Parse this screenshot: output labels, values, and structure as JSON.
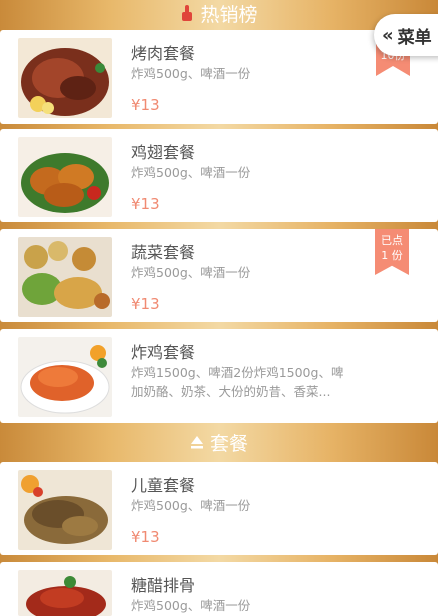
{
  "sections": {
    "hot": {
      "title": "热销榜",
      "icon": "thumb-up-icon"
    },
    "combo": {
      "title": "套餐",
      "icon": "eject-icon"
    }
  },
  "menu_tab": {
    "label": "菜单",
    "icon": "double-chevron-left-icon"
  },
  "items": [
    {
      "name": "烤肉套餐",
      "desc": "炸鸡500g、啤酒一份",
      "price": "¥13",
      "badge": "10份"
    },
    {
      "name": "鸡翅套餐",
      "desc": "炸鸡500g、啤酒一份",
      "price": "¥13"
    },
    {
      "name": "蔬菜套餐",
      "desc": "炸鸡500g、啤酒一份",
      "price": "¥13",
      "badge_line1": "已点",
      "badge_line2": "1 份"
    },
    {
      "name": "炸鸡套餐",
      "desc": "炸鸡1500g、啤酒2份炸鸡1500g、啤加奶酪、奶茶、大份的奶昔、香菜..."
    },
    {
      "name": "儿童套餐",
      "desc": "炸鸡500g、啤酒一份",
      "price": "¥13"
    },
    {
      "name": "糖醋排骨",
      "desc": "炸鸡500g、啤酒一份"
    }
  ],
  "colors": {
    "accent": "#f08a72",
    "ribbon": "#f58c74"
  }
}
